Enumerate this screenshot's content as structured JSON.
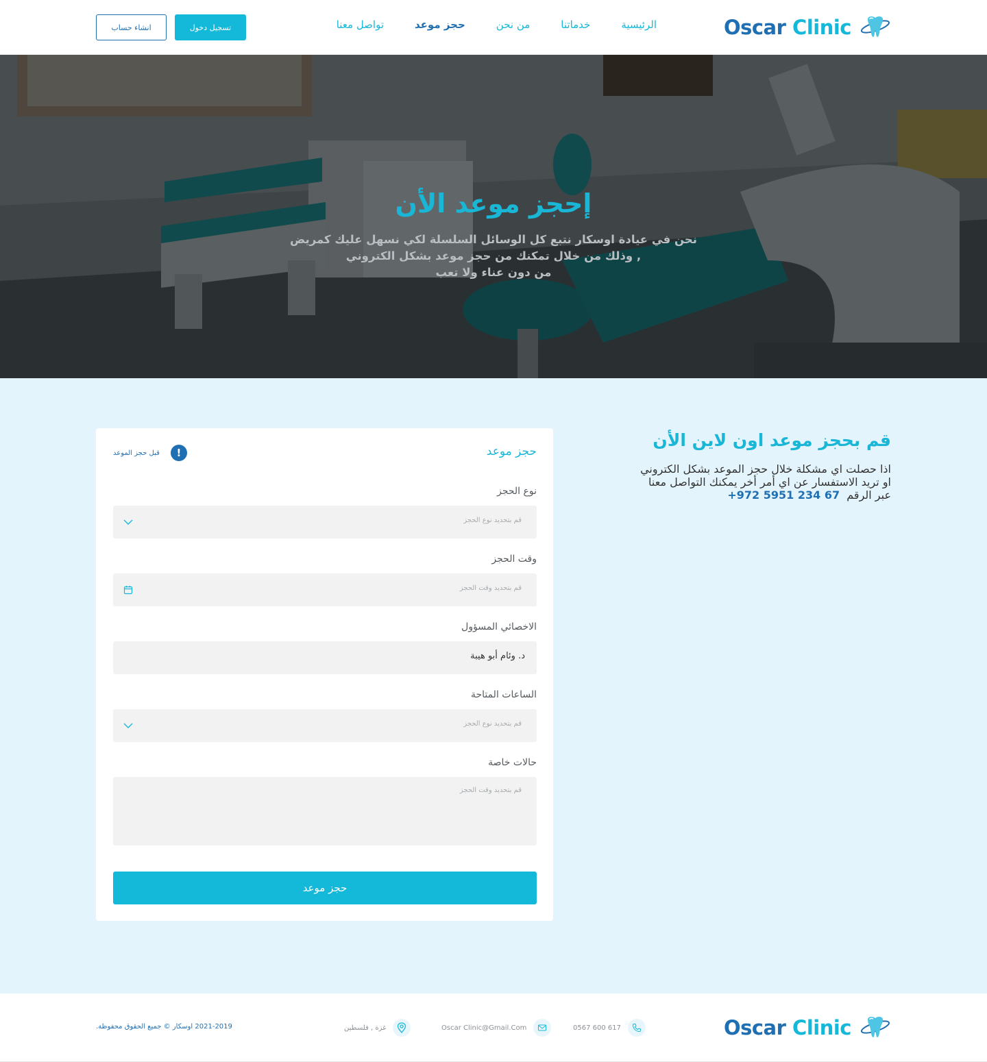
{
  "brand": {
    "word1": "Oscar",
    "word2": "Clinic"
  },
  "nav": {
    "items": [
      {
        "label": "الرئيسية"
      },
      {
        "label": "خدماتنا"
      },
      {
        "label": "من نحن"
      },
      {
        "label": "حجز موعد"
      },
      {
        "label": "تواصل معنا"
      }
    ],
    "active": "حجز موعد"
  },
  "header": {
    "login_label": "تسجيل دخول",
    "register_label": "انشاء حساب"
  },
  "hero": {
    "title": "إحجز موعد الأن",
    "subtitle_lines": [
      "نحن في عيادة اوسكار نتبع كل الوسائل السلسلة لكي نسهل عليك كمريض",
      ", وذلك من خلال تمكنك من حجز موعد بشكل الكتروني",
      "من دون عناء ولا تعب"
    ]
  },
  "info": {
    "heading": "قم بحجز موعد اون لاين الأن",
    "lines": [
      "اذا حصلت اي مشكلة خلال حجز الموعد بشكل الكتروني",
      "او تريد الاستفسار عن اي أمر أخر يمكنك التواصل معنا"
    ],
    "via_label": "عبر الرقم",
    "phone": "+972 5951 234 67"
  },
  "form": {
    "title": "حجز موعد",
    "notice": "قبل حجز الموعد",
    "fields": [
      {
        "label": "نوع الحجز",
        "placeholder": "قم بتحديد نوع الحجز"
      },
      {
        "label": "وقت الحجز",
        "placeholder": "قم بتحديد وقت الحجز"
      },
      {
        "label": "الاخصائي المسؤول",
        "value": "د. وئام أبو هيبة"
      },
      {
        "label": "الساعات المتاحة",
        "placeholder": "قم بتحديد نوع الحجز"
      },
      {
        "label": "حالات خاصة",
        "placeholder": "قم بتحديد وقت الحجز"
      }
    ],
    "submit_label": "حجز موعد"
  },
  "footer": {
    "phone": "0567 600 617",
    "email": "Oscar Clinic@Gmail.Com",
    "location": "غزة , فلسطين",
    "copyright": "2021-2019  اوسكار ©  جميع الحقوق محفوظة."
  },
  "colors": {
    "primary": "#14b8d9",
    "brand_dark": "#1f6fb2",
    "section_bg": "#e4f4fc"
  }
}
